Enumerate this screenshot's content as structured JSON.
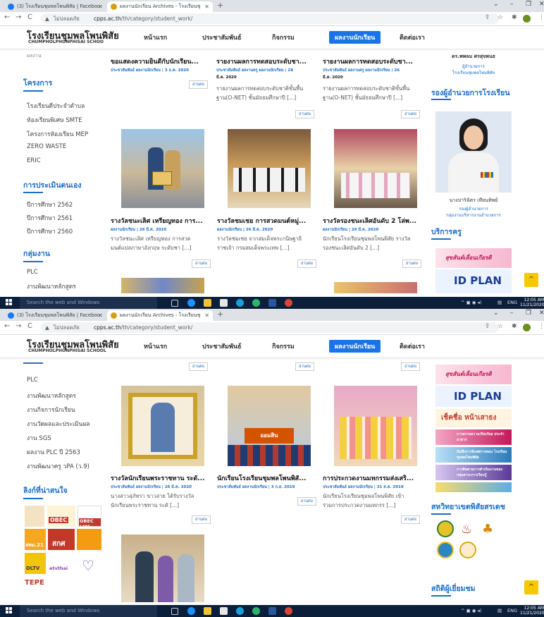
{
  "browser": {
    "tabs": [
      {
        "label": "(3) โรงเรียนชุมพลโพนพิสัย | Faceboo"
      },
      {
        "label": "ผลงานนักเรียน Archives - โรงเรียนชุ"
      }
    ],
    "not_secure": "ไม่ปลอดภัย",
    "url_host": "cpps.ac.th",
    "url_path": "/th/category/student_work/"
  },
  "site": {
    "title": "โรงเรียนชุมพลโพนพิสัย",
    "subtitle": "CHUMPHOLPHONPHISAI SCHOOL",
    "subtitle_cut": "CHUMPHOLPHONPHISAI SCHOO",
    "menu": [
      "หน้าแรก",
      "ประชาสัมพันธ์",
      "กิจกรรม",
      "ผลงานนักเรียน",
      "ติดต่อเรา"
    ]
  },
  "more_label": "อ่านต่อ",
  "shot1": {
    "sidebar_cut": "ผลงาน",
    "sidebar_sections": [
      {
        "title": "โครงการ",
        "items": [
          "โรงเรียนดีประจำตำบล",
          "ห้องเรียนพิเศษ SMTE",
          "โครงการห้องเรียน MEP",
          "ZERO WASTE",
          "ERIC"
        ]
      },
      {
        "title": "การประเมินตนเอง",
        "items": [
          "ปีการศึกษา 2562",
          "ปีการศึกษา 2561",
          "ปีการศึกษา 2560"
        ]
      },
      {
        "title": "กลุ่มงาน",
        "items": [
          "PLC",
          "งานพัฒนาหลักสูตร"
        ]
      }
    ],
    "cards_top": [
      {
        "title": "ขอแสดงความยินดีกับนักเรียน...",
        "meta": "ประชาสัมพันธ์ ผลงานนักเรียน | 3 ธ.ค. 2020",
        "excerpt": []
      },
      {
        "title": "รายงานผลการทดสอบระดับชา...",
        "meta": "ประชาสัมพันธ์ ผลงานครู ผลงานนักเรียน | 28",
        "meta2": "มี.ค. 2020",
        "excerpt": [
          "รายงานผลการทดสอบระดับชาติขั้นพื้น",
          "ฐาน(O-NET) ชั้นมัธยมศึกษาปี [...]"
        ]
      },
      {
        "title": "รายงานผลการทดสอบระดับชา...",
        "meta": "ประชาสัมพันธ์ ผลงานครู ผลงานนักเรียน | 26",
        "meta2": "มี.ค. 2020",
        "excerpt": [
          "รายงานผลการทดสอบระดับชาติขั้นพื้น",
          "ฐาน(O-NET) ชั้นมัธยมศึกษาปี [...]"
        ]
      }
    ],
    "cards_mid": [
      {
        "title": "รางวัลชนะเลิศ เหรียญทอง การ...",
        "meta": "ผลงานนักเรียน | 26 มี.ค. 2020",
        "excerpt": [
          "รางวัลชนะเลิศ เหรียญทอง การสวด",
          "มนต์แปลภาษาอังกฤษ ระดับชา [...]"
        ]
      },
      {
        "title": "รางวัลชมเชย การสวดมนต์หมู่...",
        "meta": "ผลงานนักเรียน | 26 มี.ค. 2020",
        "excerpt": [
          "รางวัลชมเชย จากสมเด็จพระกนิษฐาธิ",
          "ราชเจ้า กรมสมเด็จพระเทพ [...]"
        ]
      },
      {
        "title": "รางวัลรองชนะเลิศอันดับ 2 โล่พ...",
        "meta": "ผลงานนักเรียน | 26 มี.ค. 2020",
        "excerpt": [
          "นักเรียนโรงเรียนชุมพลโพนพิสัย รางวัล",
          "รองชนะเลิศอันดับ 2 [...]"
        ]
      }
    ],
    "right": {
      "top_name": "ดร.พพลม ศรสุจพนธ",
      "top_role": "ผู้อำนวยการ",
      "top_role2": "โรงเรียนชุมพลโพนพิสัย",
      "deputy_heading": "รองผู้อำนวยการโรงเรียน",
      "deputy_name": "นางปาริฉัตร เทียนทิพย์",
      "deputy_role": "รองผู้อำนวยการ",
      "deputy_role2": "กลุ่มงานบริหารงานอำนวยการ",
      "service_heading": "บริการครู",
      "banner1": "สุขสันต์เลื่อนเกียรติ",
      "banner2": "ID PLAN"
    }
  },
  "shot2": {
    "sidebar_items_top": [
      "PLC",
      "งานพัฒนาหลักสูตร",
      "งานกิจการนักเรียน",
      "งานวัดผลและประเมินผล",
      "งาน SGS",
      "ผลงาน PLC ปี 2563",
      "งานพัฒนาครู วPA (ว.9)"
    ],
    "links_heading": "ลิงก์ที่น่าสนใจ",
    "logos": [
      "OBEC",
      "OBEC LMS",
      "สพม.21",
      "สกศ",
      "DLTV",
      "etvthai",
      "TEPE"
    ],
    "cards": [
      {
        "title": "รางวัลนักเรียนพระราชทาน ระดั...",
        "meta": "ประชาสัมพันธ์ ผลงานนักเรียน | 26 มี.ค. 2020",
        "excerpt": [
          "นางสาวสุภัทรา ขาวสาย ได้รับรางวัล",
          "นักเรียนพระราชทาน ระดั [...]"
        ]
      },
      {
        "title": "นักเรียนโรงเรียนชุมพลโพนพิสั...",
        "meta": "ประชาสัมพันธ์ ผลงานนักเรียน | 3 ก.ย. 2019",
        "excerpt": []
      },
      {
        "title": "การประกวดงานมหกรรมส่งเสริ...",
        "meta": "ประชาสัมพันธ์ ผลงานนักเรียน | 31 ส.ค. 2019",
        "excerpt": [
          "นักเรียนโรงเรียนชุมพลโพนพิสัย เข้า",
          "ร่วมการประกวดงานมหกรร [...]"
        ]
      }
    ],
    "right": {
      "banner1": "สุขสันต์เลื่อนเกียรติ",
      "banner2": "ID PLAN",
      "banner3": "เช็คชื่อ หน้าเสาธง",
      "banner4": "การตรวจความเรียบร้อย ประจำอาคาร",
      "banner5": "บันทึกการนิเทศการสอน โรงเรียนชุมพลโพนพิสัย",
      "banner6": "การติดตามการดำเนินงานของกลุ่มสาระการเรียนรู้",
      "network_heading": "สหวิทยาเขตพิสัยสรเดช",
      "stats_heading": "สถิติผู้เยี่ยมชม"
    }
  },
  "taskbar": {
    "search": "Search the web and Windows",
    "lang": "ENG",
    "time": "12:05 AM",
    "date": "11/21/2020"
  },
  "colors": {
    "accent": "#1a6ec9",
    "menu_active": "#1a73e8",
    "taskbar": "#0b1f3a"
  }
}
